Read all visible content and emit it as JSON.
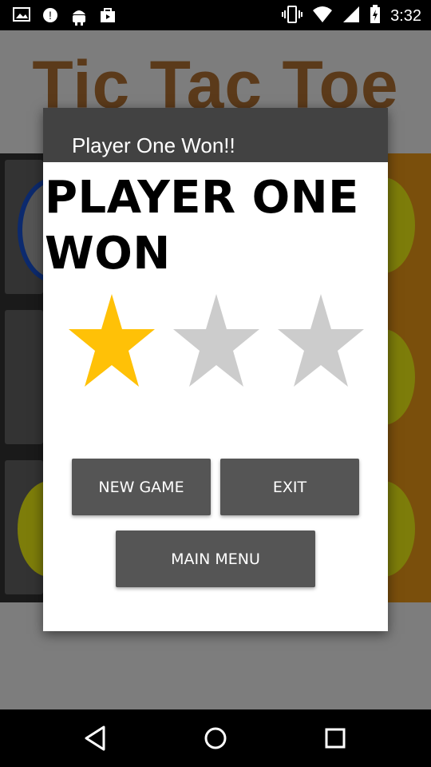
{
  "status_bar": {
    "time": "3:32",
    "left_icons": [
      "image-icon",
      "sync-icon",
      "android-icon",
      "shopping-bag-icon"
    ],
    "right_icons": [
      "vibrate-icon",
      "wifi-icon",
      "cell-signal-icon",
      "battery-icon"
    ]
  },
  "app": {
    "title": "Tic Tac Toe"
  },
  "dialog": {
    "title": "Player One Won!!",
    "message": "PLAYER ONE WON",
    "rating": 1,
    "rating_max": 3,
    "colors": {
      "star_filled": "#FFC107",
      "star_empty": "#CCCCCC",
      "header": "#424242",
      "button": "#555555"
    },
    "buttons": {
      "new_game": "NEW GAME",
      "exit": "EXIT",
      "main_menu": "MAIN MENU"
    }
  },
  "navigation": {
    "icons": [
      "back-icon",
      "home-icon",
      "recents-icon"
    ]
  }
}
